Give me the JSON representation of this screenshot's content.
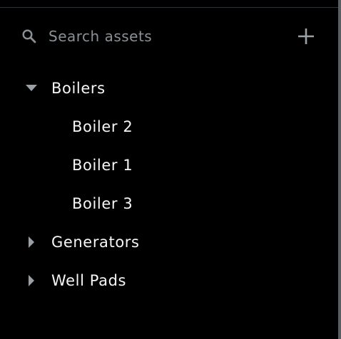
{
  "search": {
    "placeholder": "Search assets"
  },
  "toolbar": {
    "add_icon": "plus-icon"
  },
  "tree": {
    "groups": [
      {
        "label": "Boilers",
        "expanded": true,
        "children": [
          "Boiler 2",
          "Boiler 1",
          "Boiler 3"
        ]
      },
      {
        "label": "Generators",
        "expanded": false,
        "children": []
      },
      {
        "label": "Well Pads",
        "expanded": false,
        "children": []
      }
    ]
  },
  "colors": {
    "background": "#000000",
    "text": "#f5f6f7",
    "muted": "#8b9096",
    "icon": "#9aa0a6"
  }
}
